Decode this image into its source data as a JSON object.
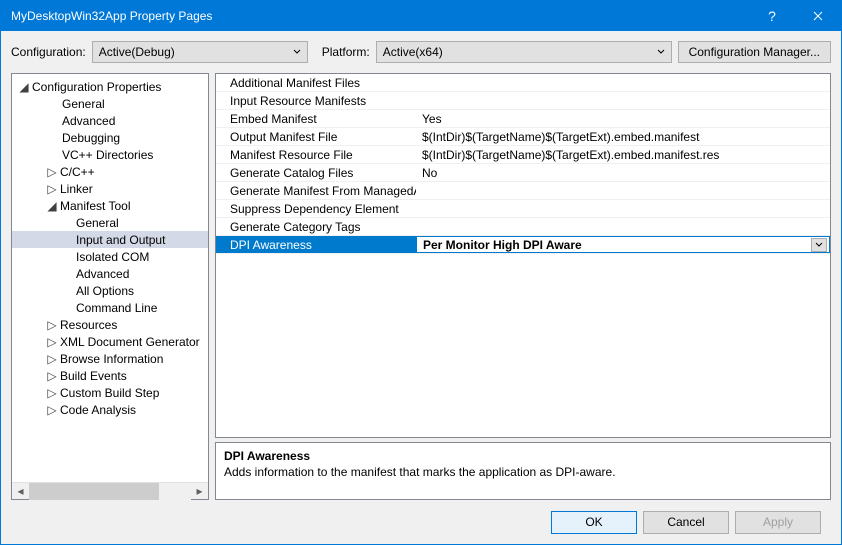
{
  "window": {
    "title": "MyDesktopWin32App Property Pages"
  },
  "top": {
    "config_label": "Configuration:",
    "config_value": "Active(Debug)",
    "platform_label": "Platform:",
    "platform_value": "Active(x64)",
    "config_mgr": "Configuration Manager..."
  },
  "tree": {
    "root": "Configuration Properties",
    "items": [
      "General",
      "Advanced",
      "Debugging",
      "VC++ Directories"
    ],
    "collapsed": [
      "C/C++",
      "Linker"
    ],
    "manifest_tool": "Manifest Tool",
    "manifest_children": [
      "General",
      "Input and Output",
      "Isolated COM",
      "Advanced",
      "All Options",
      "Command Line"
    ],
    "selected": "Input and Output",
    "bottom": [
      "Resources",
      "XML Document Generator",
      "Browse Information",
      "Build Events",
      "Custom Build Step",
      "Code Analysis"
    ]
  },
  "grid": {
    "rows": [
      {
        "name": "Additional Manifest Files",
        "value": ""
      },
      {
        "name": "Input Resource Manifests",
        "value": ""
      },
      {
        "name": "Embed Manifest",
        "value": "Yes"
      },
      {
        "name": "Output Manifest File",
        "value": "$(IntDir)$(TargetName)$(TargetExt).embed.manifest"
      },
      {
        "name": "Manifest Resource File",
        "value": "$(IntDir)$(TargetName)$(TargetExt).embed.manifest.res"
      },
      {
        "name": "Generate Catalog Files",
        "value": "No"
      },
      {
        "name": "Generate Manifest From ManagedAssembly",
        "value": ""
      },
      {
        "name": "Suppress Dependency Element",
        "value": ""
      },
      {
        "name": "Generate Category Tags",
        "value": ""
      }
    ],
    "selected": {
      "name": "DPI Awareness",
      "value": "Per Monitor High DPI Aware"
    }
  },
  "desc": {
    "title": "DPI Awareness",
    "text": "Adds information to the manifest that marks the application as DPI-aware."
  },
  "footer": {
    "ok": "OK",
    "cancel": "Cancel",
    "apply": "Apply"
  }
}
